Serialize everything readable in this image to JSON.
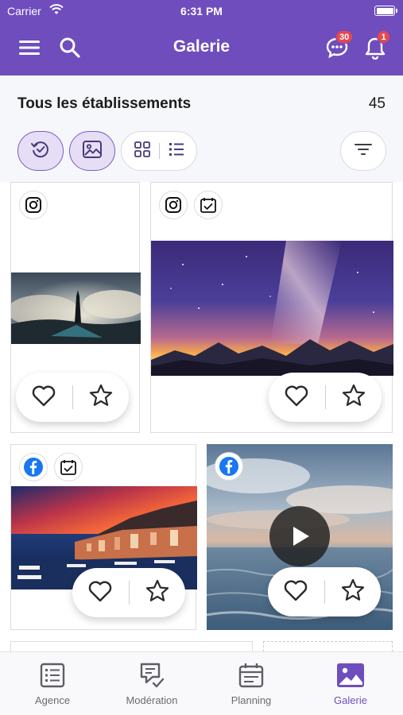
{
  "status_bar": {
    "carrier": "Carrier",
    "time": "6:31 PM"
  },
  "header": {
    "title": "Galerie",
    "chat_badge": "30",
    "notif_badge": "1",
    "color": "#6f4dbd"
  },
  "toolbar": {
    "title": "Tous les établissements",
    "count": "45"
  },
  "gallery": {
    "cards": [
      {
        "network": "instagram",
        "scheduled": false,
        "type": "photo"
      },
      {
        "network": "instagram",
        "scheduled": true,
        "type": "photo"
      },
      {
        "network": "facebook",
        "scheduled": true,
        "type": "photo"
      },
      {
        "network": "facebook",
        "scheduled": false,
        "type": "video"
      }
    ]
  },
  "tabbar": {
    "items": [
      {
        "label": "Agence",
        "icon": "list-icon",
        "active": false
      },
      {
        "label": "Modération",
        "icon": "moderation-icon",
        "active": false
      },
      {
        "label": "Planning",
        "icon": "calendar-icon",
        "active": false
      },
      {
        "label": "Galerie",
        "icon": "image-icon",
        "active": true
      }
    ],
    "active_color": "#6f4dbd"
  }
}
